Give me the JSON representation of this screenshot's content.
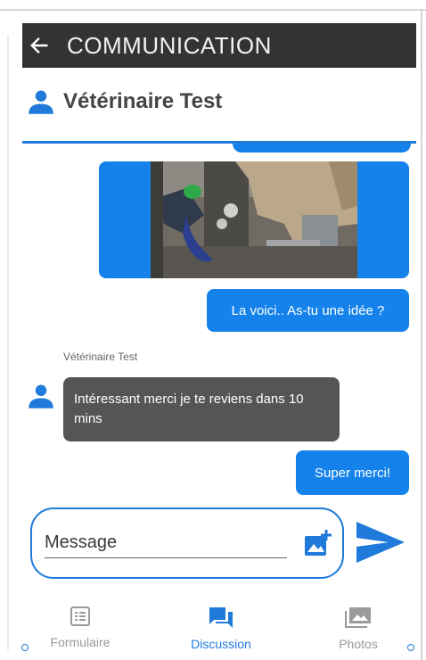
{
  "header": {
    "title": "COMMUNICATION"
  },
  "contact": {
    "name": "Vétérinaire Test"
  },
  "messages": [
    {
      "direction": "out",
      "type": "image"
    },
    {
      "direction": "out",
      "type": "text",
      "text": "La voici.. As-tu une idée ?"
    },
    {
      "direction": "in",
      "type": "text",
      "sender": "Vétérinaire Test",
      "text": "Intéressant merci je te reviens dans 10 mins"
    },
    {
      "direction": "out",
      "type": "text",
      "text": "Super merci!"
    }
  ],
  "composer": {
    "placeholder": "Message",
    "value": ""
  },
  "nav": [
    {
      "label": "Formulaire",
      "icon": "list-icon",
      "active": false
    },
    {
      "label": "Discussion",
      "icon": "chat-icon",
      "active": true
    },
    {
      "label": "Photos",
      "icon": "photos-icon",
      "active": false
    }
  ],
  "colors": {
    "accent": "#1482ea",
    "header_bg": "#333333",
    "incoming_bg": "#555555",
    "inactive": "#999999"
  }
}
